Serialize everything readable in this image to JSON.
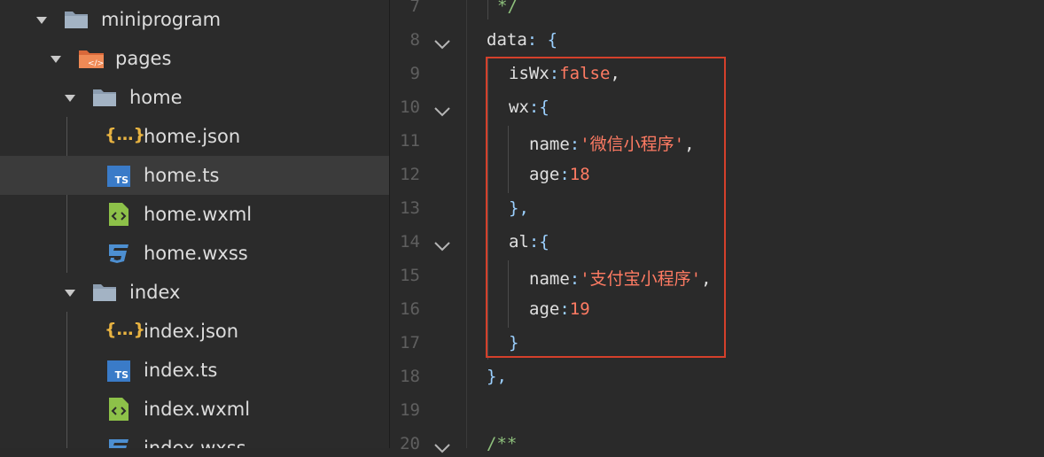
{
  "explorer": {
    "items": [
      {
        "label": "miniprogram",
        "icon": "folder-icon",
        "expanded": true
      },
      {
        "label": "pages",
        "icon": "pages-folder-icon",
        "expanded": true
      },
      {
        "label": "home",
        "icon": "folder-icon",
        "expanded": true
      },
      {
        "label": "home.json",
        "icon": "json-icon"
      },
      {
        "label": "home.ts",
        "icon": "ts-icon",
        "selected": true
      },
      {
        "label": "home.wxml",
        "icon": "wxml-icon"
      },
      {
        "label": "home.wxss",
        "icon": "css-icon"
      },
      {
        "label": "index",
        "icon": "folder-icon",
        "expanded": true
      },
      {
        "label": "index.json",
        "icon": "json-icon"
      },
      {
        "label": "index.ts",
        "icon": "ts-icon"
      },
      {
        "label": "index.wxml",
        "icon": "wxml-icon"
      },
      {
        "label": "index.wxss",
        "icon": "css-icon"
      }
    ],
    "icon_text": {
      "json": "{…}",
      "ts": "TS"
    }
  },
  "editor": {
    "line_numbers": [
      "7",
      "8",
      "9",
      "10",
      "11",
      "12",
      "13",
      "14",
      "15",
      "16",
      "17",
      "18",
      "19",
      "20"
    ],
    "folded_lines": [
      "8",
      "10",
      "14",
      "20"
    ],
    "lines": [
      {
        "parts": [
          {
            "t": "*/",
            "c": "comment"
          }
        ]
      },
      {
        "parts": [
          {
            "t": "data",
            "c": "key"
          },
          {
            "t": ": {",
            "c": "punc"
          }
        ]
      },
      {
        "parts": [
          {
            "t": "isWx",
            "c": "key"
          },
          {
            "t": ":",
            "c": "punc"
          },
          {
            "t": "false",
            "c": "val"
          },
          {
            "t": ",",
            "c": "key"
          }
        ]
      },
      {
        "parts": [
          {
            "t": "wx",
            "c": "key"
          },
          {
            "t": ":{",
            "c": "punc"
          }
        ]
      },
      {
        "parts": [
          {
            "t": "name",
            "c": "key"
          },
          {
            "t": ":",
            "c": "punc"
          },
          {
            "t": "'微信小程序'",
            "c": "val"
          },
          {
            "t": ",",
            "c": "key"
          }
        ]
      },
      {
        "parts": [
          {
            "t": "age",
            "c": "key"
          },
          {
            "t": ":",
            "c": "punc"
          },
          {
            "t": "18",
            "c": "val"
          }
        ]
      },
      {
        "parts": [
          {
            "t": "},",
            "c": "punc"
          }
        ]
      },
      {
        "parts": [
          {
            "t": "al",
            "c": "key"
          },
          {
            "t": ":{",
            "c": "punc"
          }
        ]
      },
      {
        "parts": [
          {
            "t": "name",
            "c": "key"
          },
          {
            "t": ":",
            "c": "punc"
          },
          {
            "t": "'支付宝小程序'",
            "c": "val"
          },
          {
            "t": ",",
            "c": "key"
          }
        ]
      },
      {
        "parts": [
          {
            "t": "age",
            "c": "key"
          },
          {
            "t": ":",
            "c": "punc"
          },
          {
            "t": "19",
            "c": "val"
          }
        ]
      },
      {
        "parts": [
          {
            "t": "}",
            "c": "punc"
          }
        ]
      },
      {
        "parts": [
          {
            "t": "},",
            "c": "punc"
          }
        ]
      },
      {
        "parts": []
      },
      {
        "parts": [
          {
            "t": "/**",
            "c": "comment"
          }
        ]
      }
    ],
    "colors": {
      "key": "#e0e0e0",
      "punc": "#9bd0ff",
      "val": "#ff7b63",
      "comment": "#8ec07c",
      "highlight_border": "#d4402b"
    }
  }
}
